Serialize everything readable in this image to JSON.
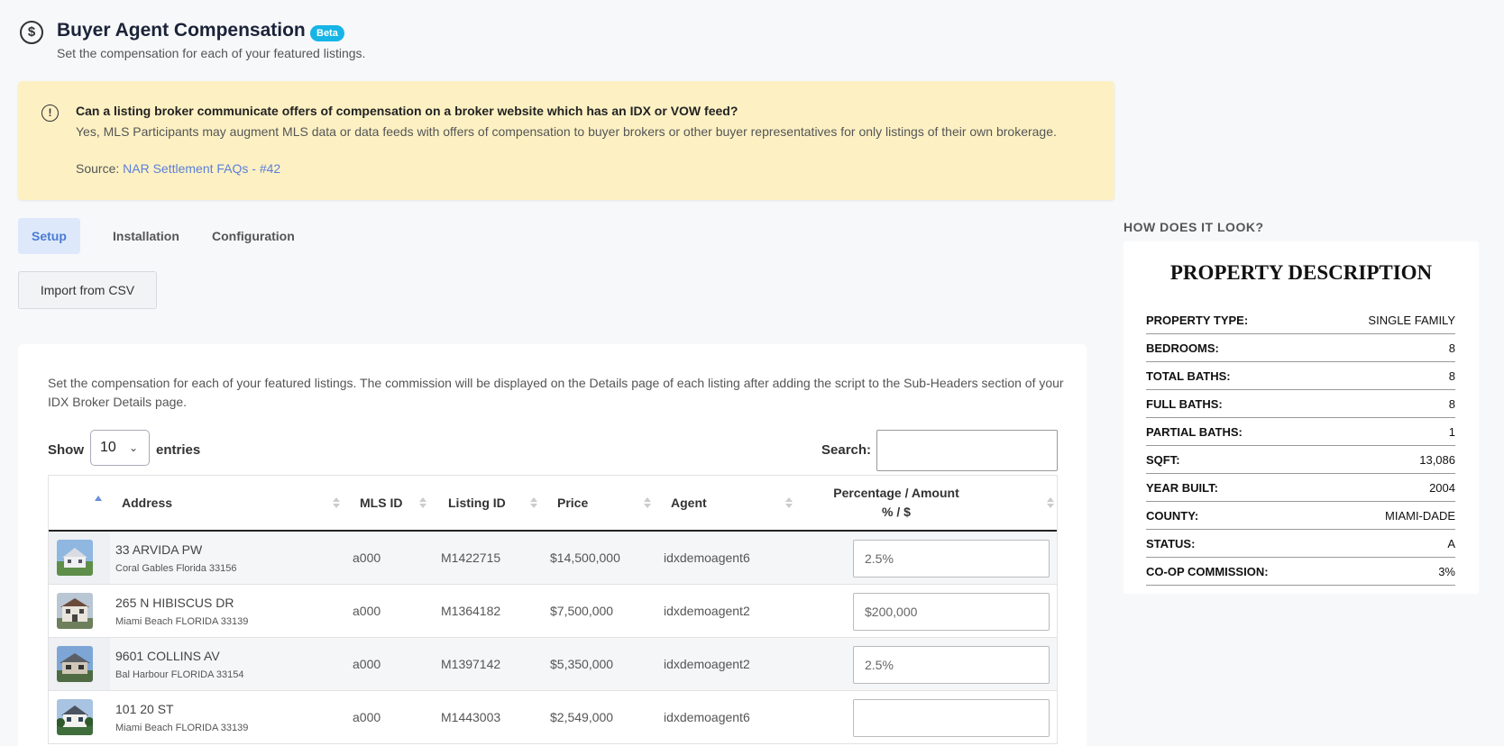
{
  "header": {
    "icon": "dollar-circle-icon",
    "title": "Buyer Agent Compensation",
    "badge": "Beta",
    "subtitle": "Set the compensation for each of your featured listings."
  },
  "notice": {
    "icon": "info-icon",
    "question": "Can a listing broker communicate offers of compensation on a broker website which has an IDX or VOW feed?",
    "answer": "Yes, MLS Participants may augment MLS data or data feeds with offers of compensation to buyer brokers or other buyer representatives for only listings of their own brokerage.",
    "source_label": "Source:",
    "source_link": "NAR Settlement FAQs - #42"
  },
  "tabs": [
    {
      "label": "Setup",
      "active": true
    },
    {
      "label": "Installation",
      "active": false
    },
    {
      "label": "Configuration",
      "active": false
    }
  ],
  "import_button": "Import from CSV",
  "listings_card": {
    "description": "Set the compensation for each of your featured listings. The commission will be displayed on the Details page of each listing after adding the script to the Sub-Headers section of your IDX Broker Details page.",
    "show_label": "Show",
    "page_length": "10",
    "entries_label": "entries",
    "search_label": "Search:",
    "search_value": "",
    "columns": [
      "Address",
      "MLS ID",
      "Listing ID",
      "Price",
      "Agent",
      "Percentage / Amount",
      "% / $"
    ],
    "rows": [
      {
        "address": "33 ARVIDA PW",
        "city": "Coral Gables Florida 33156",
        "mls_id": "a000",
        "listing_id": "M1422715",
        "price": "$14,500,000",
        "agent": "idxdemoagent6",
        "commission": "2.5%"
      },
      {
        "address": "265 N HIBISCUS DR",
        "city": "Miami Beach FLORIDA 33139",
        "mls_id": "a000",
        "listing_id": "M1364182",
        "price": "$7,500,000",
        "agent": "idxdemoagent2",
        "commission": "$200,000"
      },
      {
        "address": "9601 COLLINS AV",
        "city": "Bal Harbour FLORIDA 33154",
        "mls_id": "a000",
        "listing_id": "M1397142",
        "price": "$5,350,000",
        "agent": "idxdemoagent2",
        "commission": "2.5%"
      },
      {
        "address": "101 20 ST",
        "city": "Miami Beach FLORIDA 33139",
        "mls_id": "a000",
        "listing_id": "M1443003",
        "price": "$2,549,000",
        "agent": "idxdemoagent6",
        "commission": ""
      }
    ]
  },
  "preview": {
    "label": "HOW DOES IT LOOK?",
    "title": "PROPERTY DESCRIPTION",
    "rows": [
      {
        "key": "PROPERTY TYPE:",
        "value": "SINGLE FAMILY"
      },
      {
        "key": "BEDROOMS:",
        "value": "8"
      },
      {
        "key": "TOTAL BATHS:",
        "value": "8"
      },
      {
        "key": "FULL BATHS:",
        "value": "8"
      },
      {
        "key": "PARTIAL BATHS:",
        "value": "1"
      },
      {
        "key": "SQFT:",
        "value": "13,086"
      },
      {
        "key": "YEAR BUILT:",
        "value": "2004"
      },
      {
        "key": "COUNTY:",
        "value": "MIAMI-DADE"
      },
      {
        "key": "STATUS:",
        "value": "A"
      },
      {
        "key": "CO-OP COMMISSION:",
        "value": "3%"
      }
    ]
  },
  "colors": {
    "accent": "#4a7bd4",
    "badge": "#16b5e6",
    "notice_bg": "#fdf1c4",
    "link": "#5b7fd8"
  }
}
